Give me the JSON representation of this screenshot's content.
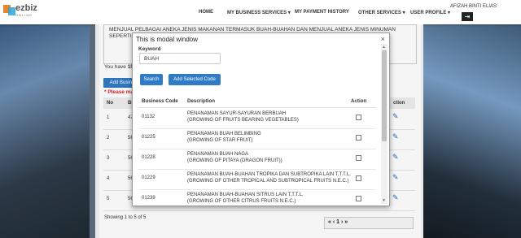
{
  "brand": {
    "logo_text": "ezbiz",
    "logo_sub": "ONLINE"
  },
  "nav": {
    "home": "HOME",
    "my_business_services": "MY BUSINESS SERVICES",
    "my_payment_history": "MY PAYMENT HISTORY",
    "other_services": "OTHER SERVICES",
    "user_profile": "USER PROFILE",
    "user_name": "AFIZAH BINTI ELIAS"
  },
  "background": {
    "textarea_text": "MENJUAL PELBAGAI ANEKA JENIS MAKANAN TERMASUK BUAH-BUAHAN DAN MENJUAL ANEKA JENIS MINUMAN SEPERTI M",
    "you_have_prefix": "You have",
    "you_have_count": "150",
    "add_business_label": "Add Busine",
    "please_note": "* Please mak",
    "table_headers": {
      "no": "No",
      "code": "Busi",
      "action": "ction"
    },
    "rows": [
      {
        "no": "1",
        "code": "479"
      },
      {
        "no": "2",
        "code": "561"
      },
      {
        "no": "3",
        "code": "561"
      },
      {
        "no": "4",
        "code": "561"
      },
      {
        "no": "5",
        "code": "562"
      }
    ],
    "showing": "Showing 1 to 5 of 5",
    "pager_text": "« ‹ 1 › »"
  },
  "modal": {
    "title": "This is modal window",
    "close": "×",
    "keyword_label": "Keyword",
    "keyword_value": "BUAH",
    "search_button": "Search",
    "add_selected_button": "Add Selected Code",
    "headers": {
      "code": "Business Code",
      "description": "Description",
      "action": "Action"
    },
    "rows": [
      {
        "code": "01132",
        "desc1": "PENANAMAN SAYUR-SAYURAN BERBUAH",
        "desc2": "(GROWING OF FRUITS BEARING VEGETABLES)"
      },
      {
        "code": "01225",
        "desc1": "PENANAMAN BUAH BELIMBING",
        "desc2": "(GROWING OF STAR FRUIT)"
      },
      {
        "code": "01228",
        "desc1": "PENANAMAN BUAH NAGA",
        "desc2": "(GROWING OF PITAYA (DRAGON FRUIT))"
      },
      {
        "code": "01229",
        "desc1": "PENANAMAN BUAH-BUAHAN TROPIKA DAN SUBTROPIKA LAIN T.T.T.L.",
        "desc2": "(GROWING OF OTHER TROPICAL AND SUBTROPICAL FRUITS N.E.C.)"
      },
      {
        "code": "01239",
        "desc1": "PENANAMAN BUAH-BUAHAN SITRUS LAIN T.T.T.L.",
        "desc2": "(GROWING OF OTHER CITRUS FRUITS N.E.C.)"
      }
    ]
  }
}
